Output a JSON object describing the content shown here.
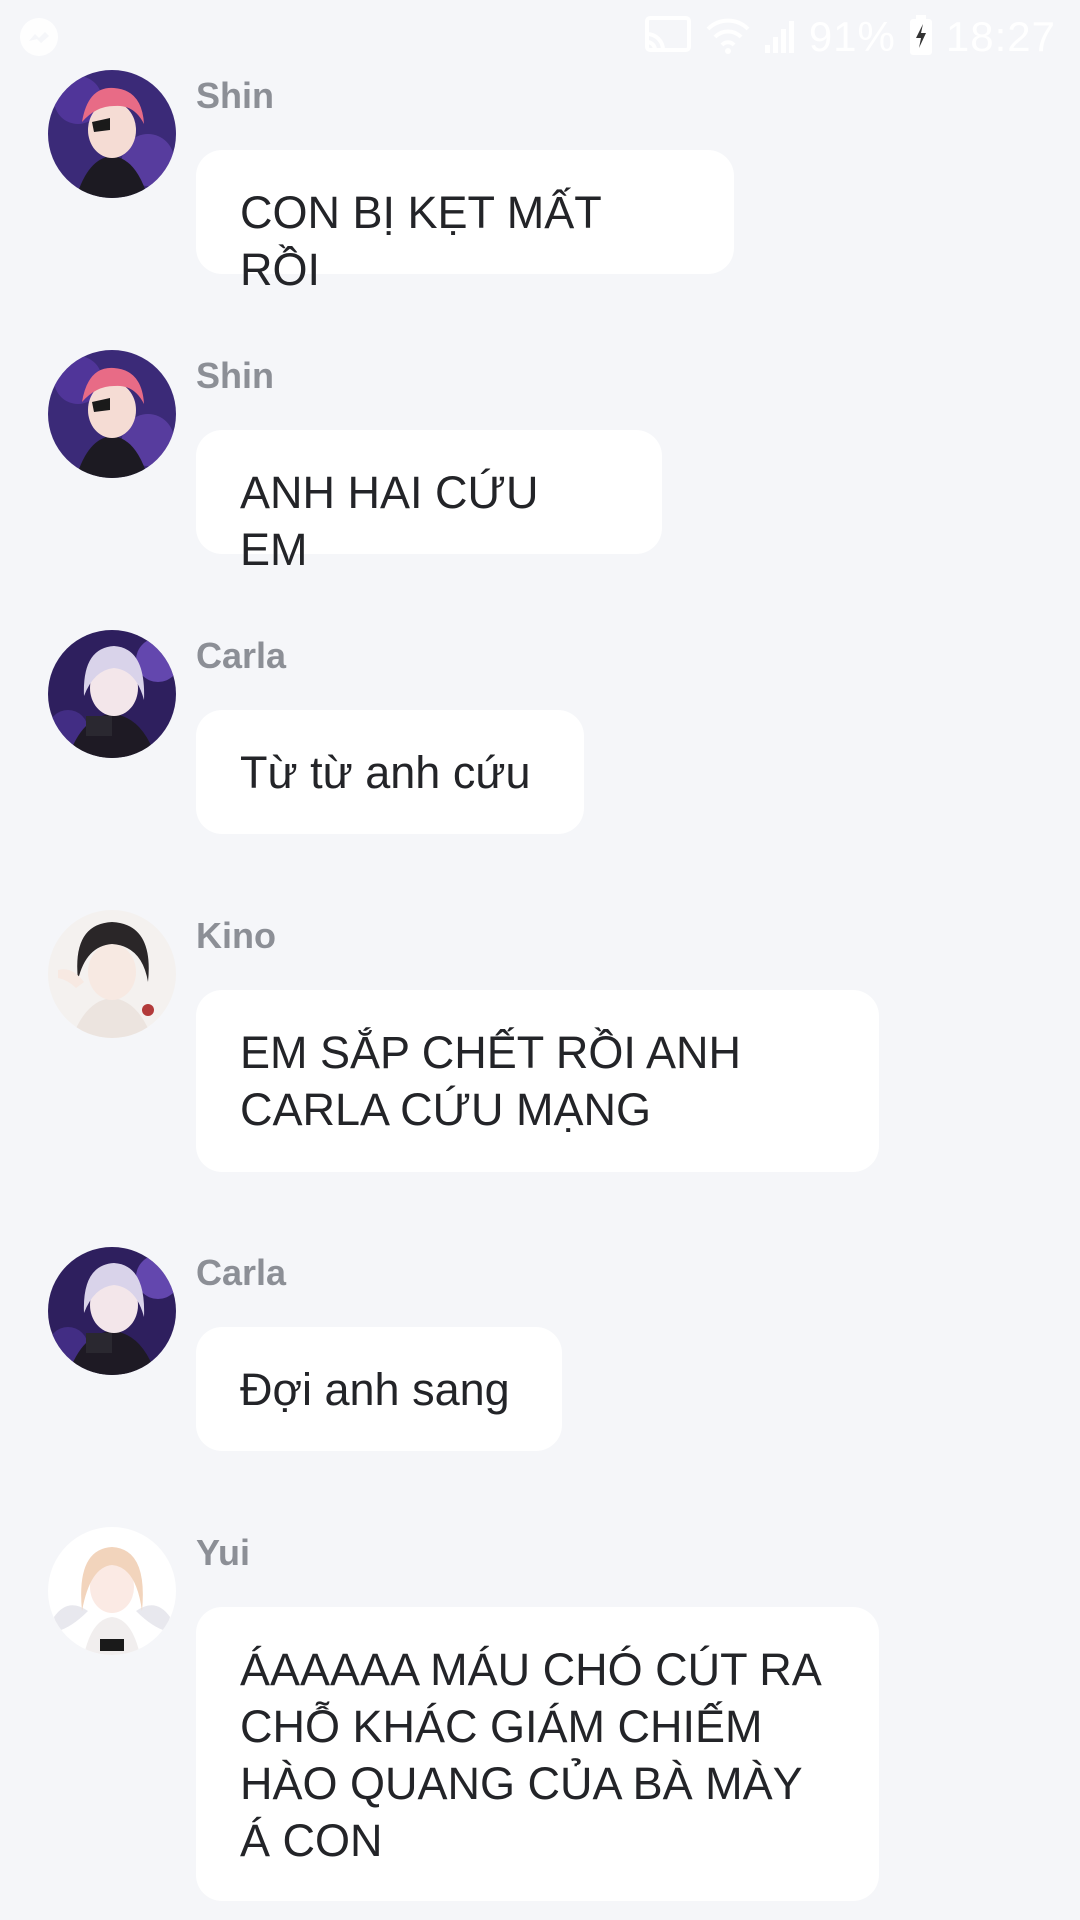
{
  "status_bar": {
    "battery": "91%",
    "time": "18:27",
    "icons": [
      "messenger-icon",
      "cast-icon",
      "wifi-icon",
      "signal-icon",
      "battery-icon"
    ]
  },
  "messages": [
    {
      "sender": "Shin",
      "avatar": "shin-avatar",
      "text": "CON BỊ KẸT MẤT RỒI"
    },
    {
      "sender": "Shin",
      "avatar": "shin-avatar",
      "text": "ANH HAI CỨU EM"
    },
    {
      "sender": "Carla",
      "avatar": "carla-avatar",
      "text": "Từ từ anh cứu"
    },
    {
      "sender": "Kino",
      "avatar": "kino-avatar",
      "text": "EM SẮP CHẾT RỒI ANH\nCARLA CỨU MẠNG"
    },
    {
      "sender": "Carla",
      "avatar": "carla-avatar",
      "text": "Đợi anh sang"
    },
    {
      "sender": "Yui",
      "avatar": "yui-avatar",
      "text": "ÁAAAAA MÁU CHÓ CÚT RA\nCHỖ KHÁC GIÁM CHIẾM\nHÀO QUANG CỦA BÀ MÀY\nÁ CON"
    }
  ]
}
